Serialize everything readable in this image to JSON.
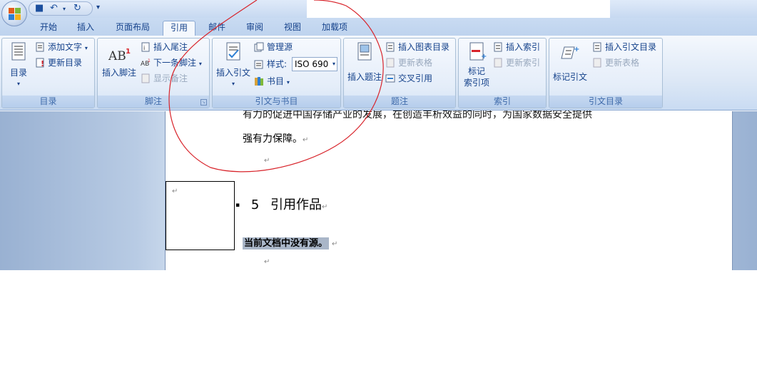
{
  "quick_access": {
    "save_icon": "save-icon",
    "undo_icon": "undo-icon",
    "redo_icon": "redo-icon",
    "customize": "▾"
  },
  "tabs": [
    "开始",
    "插入",
    "页面布局",
    "引用",
    "邮件",
    "审阅",
    "视图",
    "加载项"
  ],
  "active_tab": "引用",
  "groups": {
    "toc": {
      "label": "目录",
      "big_button": "目录",
      "add_text": "添加文字",
      "update_toc": "更新目录"
    },
    "footnotes": {
      "label": "脚注",
      "insert_footnote": "插入脚注",
      "insert_endnote": "插入尾注",
      "next_footnote": "下一条脚注",
      "show_notes": "显示备注"
    },
    "citations": {
      "label": "引文与书目",
      "insert_citation": "插入引文",
      "manage_sources": "管理源",
      "style_label": "样式:",
      "style_value": "ISO 690",
      "bibliography": "书目"
    },
    "captions": {
      "label": "题注",
      "insert_caption": "插入题注",
      "insert_table_of_figures": "插入图表目录",
      "update_table": "更新表格",
      "cross_reference": "交叉引用"
    },
    "index": {
      "label": "索引",
      "mark_entry_line1": "标记",
      "mark_entry_line2": "索引项",
      "insert_index": "插入索引",
      "update_index": "更新索引"
    },
    "toa": {
      "label": "引文目录",
      "mark_citation": "标记引文",
      "insert_toa": "插入引文目录",
      "update_table": "更新表格"
    }
  },
  "document": {
    "partial_line": "有力的促进中国存储产业的发展，在创造丰析效益的同时，为国家数据安全提供",
    "line2": "强有力保障。",
    "heading_number": "5",
    "heading_text": "引用作品",
    "no_sources_text": "当前文档中没有源。",
    "paragraph_mark": "↵",
    "bullet": "▪"
  },
  "colors": {
    "accent": "#15428b",
    "annotation": "#d8232a",
    "selection": "#a9b6c8"
  }
}
